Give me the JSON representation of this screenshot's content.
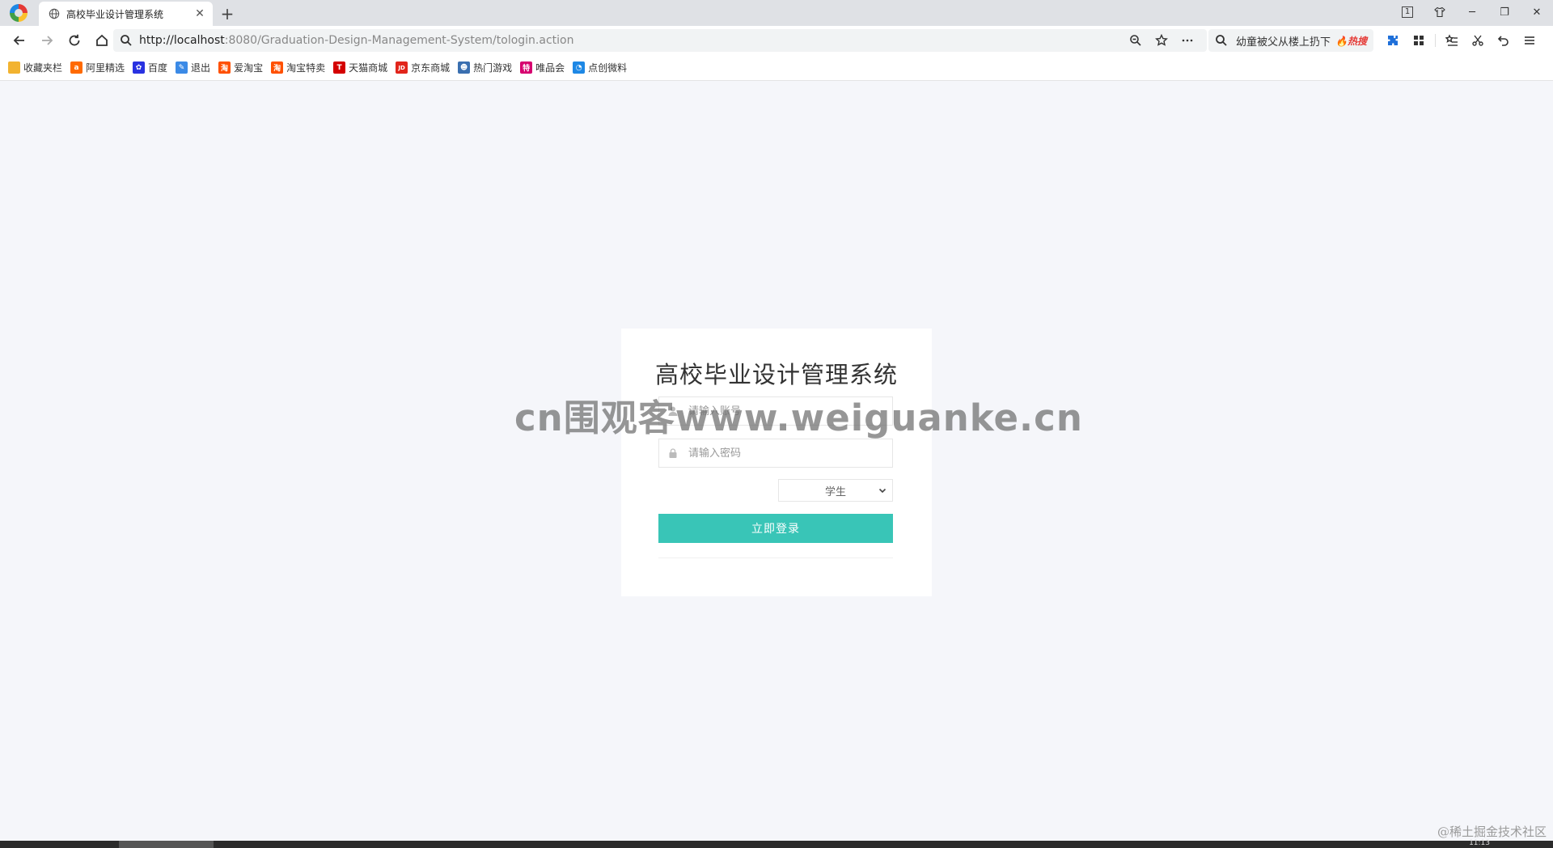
{
  "browser": {
    "tab_title": "高校毕业设计管理系统",
    "url_host": "http://localhost",
    "url_rest": ":8080/Graduation-Design-Management-System/tologin.action",
    "hot_search_text": "幼童被父从楼上扔下",
    "hot_search_badge": "热搜",
    "tab_count": "1"
  },
  "bookmarks": [
    {
      "label": "收藏夹栏",
      "icon": "folder-icon",
      "color": "#f2b330",
      "glyph": ""
    },
    {
      "label": "阿里精选",
      "icon": "alibaba-icon",
      "color": "#ff6a00",
      "glyph": "a"
    },
    {
      "label": "百度",
      "icon": "baidu-paw-icon",
      "color": "#2932e1",
      "glyph": "✿"
    },
    {
      "label": "退出",
      "icon": "feather-icon",
      "color": "#3b8ae6",
      "glyph": "✎"
    },
    {
      "label": "爱淘宝",
      "icon": "taobao-icon",
      "color": "#ff5000",
      "glyph": "淘"
    },
    {
      "label": "淘宝特卖",
      "icon": "taobao-sale-icon",
      "color": "#ff5000",
      "glyph": "淘"
    },
    {
      "label": "天猫商城",
      "icon": "tmall-icon",
      "color": "#d40000",
      "glyph": "T"
    },
    {
      "label": "京东商城",
      "icon": "jd-icon",
      "color": "#e1251b",
      "glyph": "JD"
    },
    {
      "label": "热门游戏",
      "icon": "game-icon",
      "color": "#3a6fb0",
      "glyph": "☻"
    },
    {
      "label": "唯品会",
      "icon": "vip-icon",
      "color": "#d6006f",
      "glyph": "特"
    },
    {
      "label": "点创微料",
      "icon": "dianchuang-icon",
      "color": "#1e88e5",
      "glyph": "◔"
    }
  ],
  "login": {
    "title": "高校毕业设计管理系统",
    "username_placeholder": "请输入账号",
    "password_placeholder": "请输入密码",
    "role_selected": "学生",
    "submit_label": "立即登录",
    "accent_color": "#39c5b7"
  },
  "watermark": {
    "text": "cn围观客www.weiguanke.cn",
    "corner": "@稀土掘金技术社区"
  },
  "taskbar": {
    "time": "11:13"
  }
}
